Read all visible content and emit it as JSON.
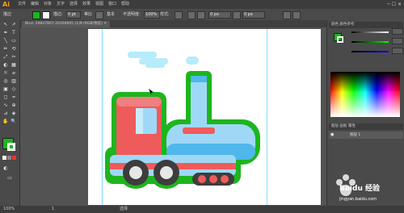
{
  "app": {
    "logo": "Ai",
    "window_controls": "─ ☐ ✕"
  },
  "menu": [
    "文件",
    "编辑",
    "对象",
    "文字",
    "选择",
    "效果",
    "视图",
    "窗口",
    "帮助"
  ],
  "controlbar": {
    "left_label": "描边",
    "stroke_label": "描边:",
    "stroke_value": "0 pt",
    "uniform_label": "等比",
    "basic_label": "基本",
    "opacity_label": "不透明度:",
    "opacity_value": "100%",
    "style_label": "样式:",
    "x_value": "0 px",
    "w_value": "0 px",
    "fill_color": "#19b819",
    "stroke_color": "#ffffff"
  },
  "document": {
    "tab_title": "Nice: 29847807 20160605 (1)9 (RGB/预览) ✕"
  },
  "tools": [
    "↖",
    "↗",
    "✒",
    "T",
    "╲",
    "▭",
    "✏",
    "⟲",
    "⤢",
    "✂",
    "◐",
    "▦",
    "☼",
    "✋",
    "🔍"
  ],
  "panels": {
    "color_header": "颜色  颜色参考",
    "layers_header": "图层  画板  属性",
    "layer_name": "图层 1"
  },
  "statusbar": {
    "zoom": "100%",
    "page": "1",
    "mode": "选择",
    "left_text": "100%"
  },
  "watermark": {
    "brand": "Baidu 经验",
    "url": "jingyan.baidu.com"
  }
}
